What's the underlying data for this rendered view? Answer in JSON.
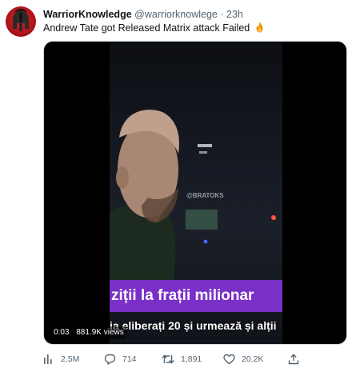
{
  "tweet": {
    "display_name": "WarriorKnowledge",
    "handle": "@warriorknowlege",
    "separator": "·",
    "time": "23h",
    "text": "Andrew Tate got Released Matrix attack Failed",
    "emoji": "fire-icon"
  },
  "media": {
    "caption_top": "ziții la frații milionar",
    "caption_bottom": "ia eliberați 20 și urmează și alții",
    "watermark": "@BRATOKS",
    "timestamp": "0:03",
    "view_count": "881.9K views"
  },
  "actions": {
    "views": "2.5M",
    "replies": "714",
    "retweets": "1,891",
    "likes": "20.2K"
  },
  "colors": {
    "caption_bg": "#7a2fc7",
    "secondary_text": "#536471",
    "avatar_red": "#d9242a"
  }
}
